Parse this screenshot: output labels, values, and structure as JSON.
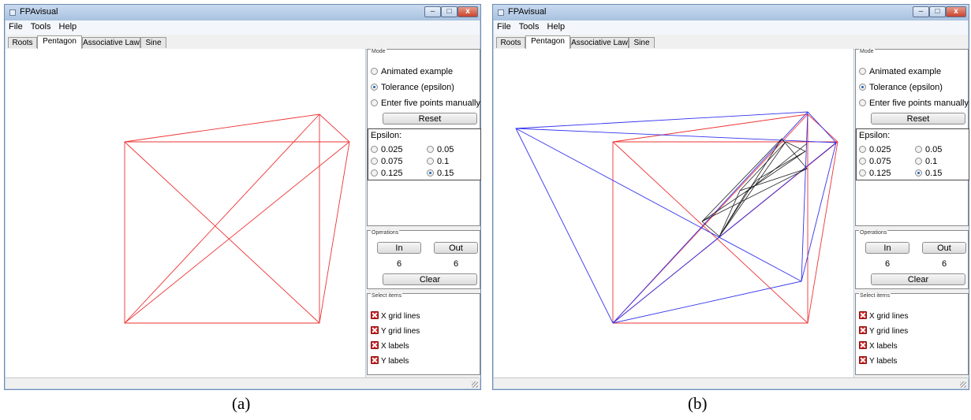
{
  "app": {
    "title": "FPAvisual",
    "window_controls": {
      "minimize": "–",
      "maximize": "□",
      "close": "x"
    }
  },
  "menu": [
    "File",
    "Tools",
    "Help"
  ],
  "tabs": [
    "Roots",
    "Pentagon",
    "Associative Law",
    "Sine"
  ],
  "active_tab": "Pentagon",
  "panel": {
    "mode_title": "Mode",
    "mode_options": [
      "Animated example",
      "Tolerance (epsilon)",
      "Enter five points manually"
    ],
    "mode_selected": "Tolerance (epsilon)",
    "reset_label": "Reset",
    "epsilon_title": "Epsilon:",
    "epsilon_options": [
      "0.025",
      "0.05",
      "0.075",
      "0.1",
      "0.125",
      "0.15"
    ],
    "epsilon_selected": "0.15",
    "operations_title": "Operations",
    "in_label": "In",
    "out_label": "Out",
    "in_count": "6",
    "out_count": "6",
    "clear_label": "Clear",
    "select_title": "Select items",
    "select_items": [
      "X grid lines",
      "Y grid lines",
      "X labels",
      "Y labels"
    ],
    "select_checked": [
      true,
      true,
      true,
      true
    ]
  },
  "captions": {
    "a": "(a)",
    "b": "(b)"
  },
  "colors": {
    "red_lines": "#ee3333",
    "blue_lines": "#3333ee",
    "black_lines": "#222222",
    "radio_dot": "#1f63b8",
    "checkbox": "#cc2222"
  }
}
